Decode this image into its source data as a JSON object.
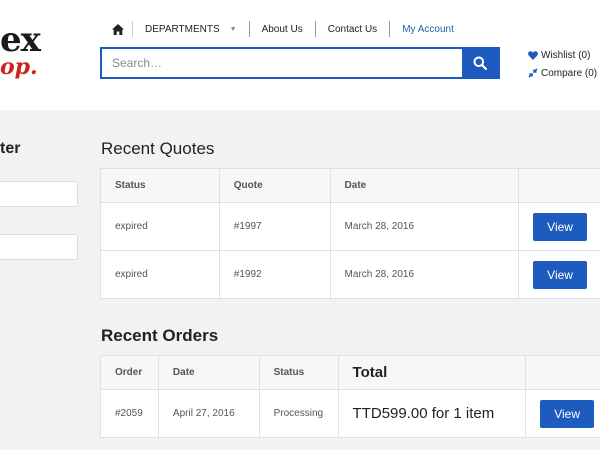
{
  "header": {
    "logo_top": "ex",
    "logo_bottom": "op.",
    "nav": {
      "home_icon": "home-icon",
      "departments": "DEPARTMENTS",
      "about": "About Us",
      "contact": "Contact Us",
      "account": "My Account"
    },
    "search": {
      "placeholder": "Search…",
      "icon": "search-icon"
    },
    "wishlist": "Wishlist (0)",
    "compare": "Compare (0)"
  },
  "sidebar": {
    "title": "ter"
  },
  "quotes": {
    "title": "Recent Quotes",
    "columns": [
      "Status",
      "Quote",
      "Date",
      ""
    ],
    "rows": [
      {
        "status": "expired",
        "quote": "#1997",
        "date": "March 28, 2016",
        "action": "View"
      },
      {
        "status": "expired",
        "quote": "#1992",
        "date": "March 28, 2016",
        "action": "View"
      }
    ]
  },
  "orders": {
    "title": "Recent Orders",
    "columns": [
      "Order",
      "Date",
      "Status",
      "Total",
      ""
    ],
    "rows": [
      {
        "order": "#2059",
        "date": "April 27, 2016",
        "status": "Processing",
        "total": "TTD599.00 for 1 item",
        "action": "View"
      }
    ]
  },
  "colors": {
    "accent": "#1e5bbf",
    "logo_red": "#cc2222"
  }
}
